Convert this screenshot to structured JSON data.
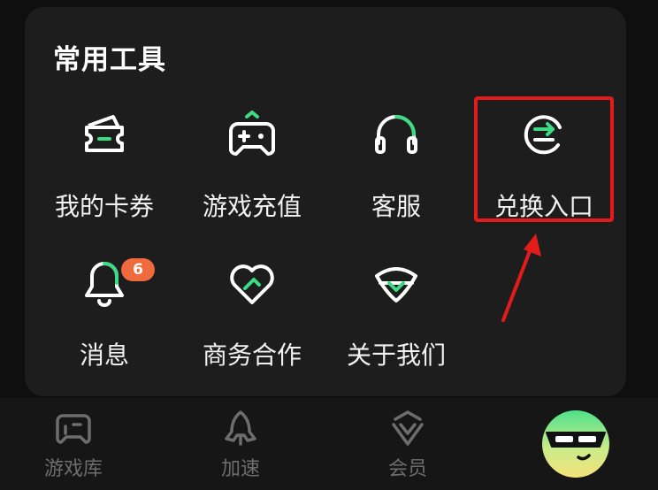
{
  "tools_card": {
    "title": "常用工具",
    "items": [
      {
        "label": "我的卡券",
        "icon": "coupon-icon"
      },
      {
        "label": "游戏充值",
        "icon": "gamepad-recharge-icon"
      },
      {
        "label": "客服",
        "icon": "headset-icon"
      },
      {
        "label": "兑换入口",
        "icon": "exchange-icon"
      },
      {
        "label": "消息",
        "icon": "bell-icon",
        "badge": "6"
      },
      {
        "label": "商务合作",
        "icon": "heart-handshake-icon"
      },
      {
        "label": "关于我们",
        "icon": "about-us-icon"
      }
    ]
  },
  "tabbar": {
    "tabs": [
      {
        "label": "游戏库",
        "icon": "game-library-icon"
      },
      {
        "label": "加速",
        "icon": "rocket-icon"
      },
      {
        "label": "会员",
        "icon": "vip-diamond-icon"
      }
    ],
    "mascot": "mascot-avatar-icon"
  },
  "colors": {
    "accent_green": "#3ddc84",
    "badge_orange": "#ef6a3c",
    "highlight_red": "#e31b1b",
    "card_bg": "#1d1d1d"
  }
}
